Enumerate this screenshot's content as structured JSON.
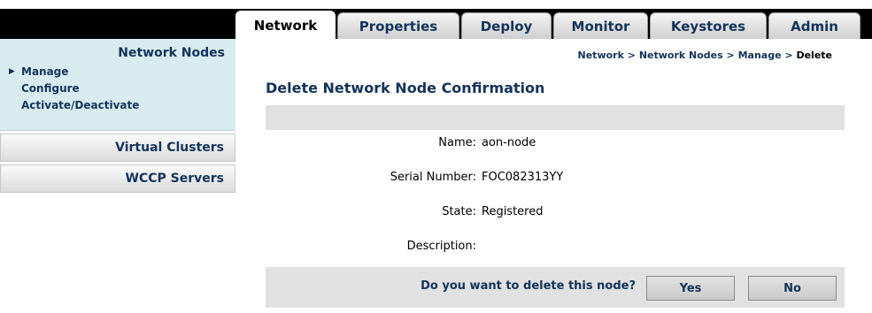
{
  "tabs": [
    {
      "label": "Network",
      "active": true
    },
    {
      "label": "Properties",
      "active": false
    },
    {
      "label": "Deploy",
      "active": false
    },
    {
      "label": "Monitor",
      "active": false
    },
    {
      "label": "Keystores",
      "active": false
    },
    {
      "label": "Admin",
      "active": false
    }
  ],
  "sidebar": {
    "section_title": "Network Nodes",
    "links": [
      {
        "label": "Manage",
        "selected": true
      },
      {
        "label": "Configure",
        "selected": false
      },
      {
        "label": "Activate/Deactivate",
        "selected": false
      }
    ],
    "bars": [
      "Virtual Clusters",
      "WCCP Servers"
    ]
  },
  "breadcrumb": {
    "items": [
      "Network",
      "Network Nodes",
      "Manage"
    ],
    "separator": ">",
    "current": "Delete"
  },
  "page_title": "Delete Network Node Confirmation",
  "fields": [
    {
      "label": "Name:",
      "value": "aon-node"
    },
    {
      "label": "Serial Number:",
      "value": "FOC082313YY"
    },
    {
      "label": "State:",
      "value": "Registered"
    },
    {
      "label": "Description:",
      "value": ""
    }
  ],
  "confirm": {
    "question": "Do you want to delete this node?",
    "yes_label": "Yes",
    "no_label": "No"
  },
  "colors": {
    "accent_text": "#13335a",
    "sidebar_bg": "#d8ecef",
    "header_bg": "#000000",
    "panel_grey": "#e1e1e1"
  },
  "icons": {
    "selected_marker": "right-triangle-icon"
  }
}
